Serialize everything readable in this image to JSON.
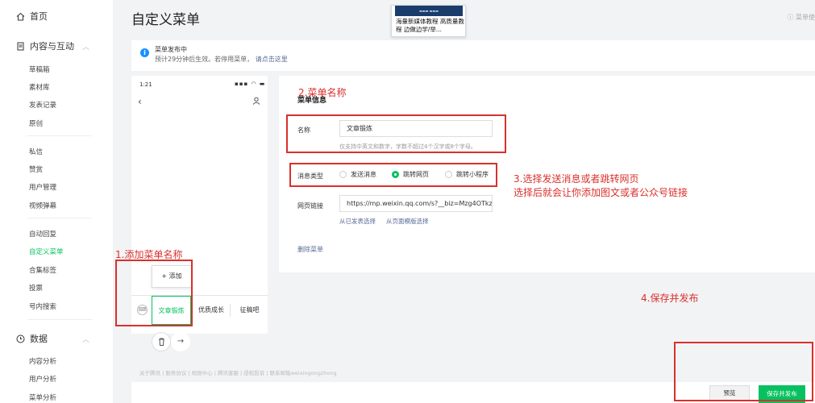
{
  "sidebar": {
    "home": "首页",
    "section_content": "内容与互动",
    "content_items": [
      "草稿箱",
      "素材库",
      "发表记录",
      "原创"
    ],
    "interact_items": [
      "私信",
      "赞赏",
      "用户管理",
      "视频弹幕"
    ],
    "feature_items": [
      "自动回复",
      "自定义菜单",
      "合集标签",
      "投票",
      "号内搜索"
    ],
    "section_data": "数据",
    "data_items": [
      "内容分析",
      "用户分析",
      "菜单分析"
    ]
  },
  "header": {
    "title": "自定义菜单",
    "help": "ⓘ 菜单使",
    "thumb_text": "海量新媒体教程 高质量教程 边做边学/举..."
  },
  "notice": {
    "line1": "菜单发布中",
    "line2": "预计29分钟后生效。若停用菜单，",
    "link": "请点击这里"
  },
  "phone": {
    "time": "1:21",
    "status": "▪▪▪ ◠ ▬",
    "add_label": "+ 添加",
    "tabs": [
      "文章锻炼",
      "优质成长",
      "征稿吧"
    ]
  },
  "editor": {
    "section": "菜单信息",
    "name_label": "名称",
    "name_value": "文章锻炼",
    "name_hint": "仅支持中英文和数字，字数不超过4个汉字或8个字母。",
    "type_label": "消息类型",
    "type_options": [
      "发送消息",
      "跳转网页",
      "跳转小程序"
    ],
    "url_label": "网页链接",
    "url_value": "https://mp.weixin.qq.com/s?__biz=Mzg4OTkz",
    "url_link1": "从已发表选择",
    "url_link2": "从页面模版选择",
    "delete": "删除菜单"
  },
  "footer": {
    "links": "关于腾讯 | 服务协议 | 规则中心 | 腾讯客服 | 侵权投诉 | 联系邮箱weixingongzhong"
  },
  "bottom": {
    "preview": "预览",
    "save": "保存并发布"
  },
  "annotations": {
    "a1": "1.添加菜单名称",
    "a2": "2.菜单名称",
    "a3_l1": "3.选择发送消息或者跳转网页",
    "a3_l2": "选择后就会让你添加图文或者公众号链接",
    "a4": "4.保存并发布"
  },
  "colors": {
    "accent": "#07c160",
    "link": "#576b95",
    "annotation": "#d9302c",
    "info": "#1890ff"
  }
}
